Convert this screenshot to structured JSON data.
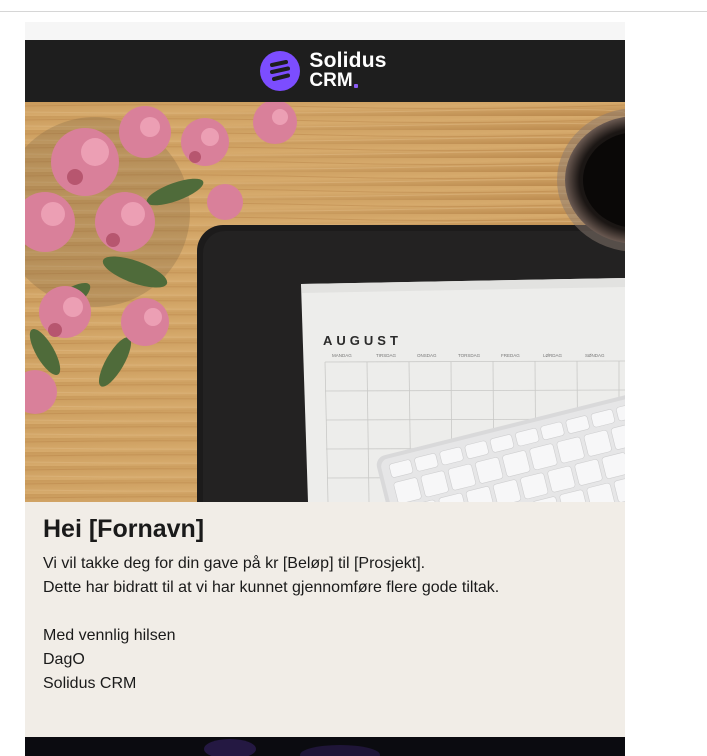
{
  "brand": {
    "name_line1": "Solidus",
    "name_line2": "CRM",
    "accent_color": "#8b5cf6",
    "header_bg": "#1e1e1e"
  },
  "hero": {
    "calendar_month": "AUGUST",
    "weekdays": [
      "MANDAG",
      "TIRSDAG",
      "ONSDAG",
      "TORSDAG",
      "FREDAG",
      "LØRDAG",
      "SØNDAG"
    ]
  },
  "message": {
    "greeting": "Hei [Fornavn]",
    "line1": "Vi vil takke deg for din gave på kr [Beløp] til [Prosjekt].",
    "line2": "Dette har bidratt til at vi har kunnet gjennomføre flere gode tiltak.",
    "closing": "Med vennlig hilsen",
    "sender": "DagO",
    "organization": "Solidus CRM",
    "background_color": "#f1ede7"
  }
}
